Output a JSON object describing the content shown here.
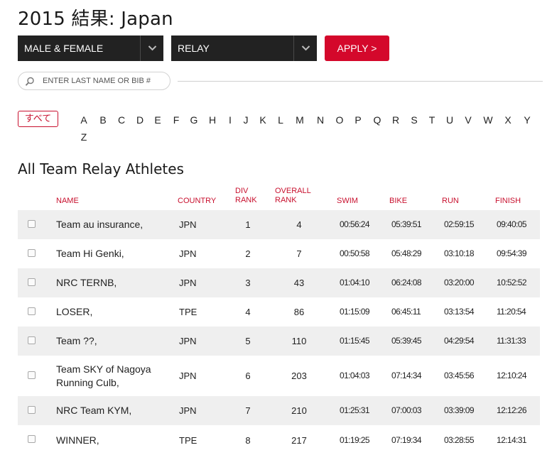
{
  "page_title": "2015 結果: Japan",
  "filters": {
    "gender": "MALE & FEMALE",
    "type": "RELAY",
    "apply_label": "APPLY >"
  },
  "search": {
    "placeholder": "ENTER LAST NAME OR BIB #"
  },
  "alphabet": {
    "all_label": "すべて",
    "letters": [
      "A",
      "B",
      "C",
      "D",
      "E",
      "F",
      "G",
      "H",
      "I",
      "J",
      "K",
      "L",
      "M",
      "N",
      "O",
      "P",
      "Q",
      "R",
      "S",
      "T",
      "U",
      "V",
      "W",
      "X",
      "Y",
      "Z"
    ]
  },
  "section_title": "All Team Relay Athletes",
  "table": {
    "headers": {
      "name": "NAME",
      "country": "COUNTRY",
      "div_rank": "DIV RANK",
      "overall_rank": "OVERALL RANK",
      "swim": "SWIM",
      "bike": "BIKE",
      "run": "RUN",
      "finish": "FINISH"
    },
    "rows": [
      {
        "name": "Team au insurance,",
        "country": "JPN",
        "div_rank": "1",
        "overall_rank": "4",
        "swim": "00:56:24",
        "bike": "05:39:51",
        "run": "02:59:15",
        "finish": "09:40:05"
      },
      {
        "name": "Team Hi Genki,",
        "country": "JPN",
        "div_rank": "2",
        "overall_rank": "7",
        "swim": "00:50:58",
        "bike": "05:48:29",
        "run": "03:10:18",
        "finish": "09:54:39"
      },
      {
        "name": "NRC TERNB,",
        "country": "JPN",
        "div_rank": "3",
        "overall_rank": "43",
        "swim": "01:04:10",
        "bike": "06:24:08",
        "run": "03:20:00",
        "finish": "10:52:52"
      },
      {
        "name": "LOSER,",
        "country": "TPE",
        "div_rank": "4",
        "overall_rank": "86",
        "swim": "01:15:09",
        "bike": "06:45:11",
        "run": "03:13:54",
        "finish": "11:20:54"
      },
      {
        "name": "Team ??,",
        "country": "JPN",
        "div_rank": "5",
        "overall_rank": "110",
        "swim": "01:15:45",
        "bike": "05:39:45",
        "run": "04:29:54",
        "finish": "11:31:33"
      },
      {
        "name": "Team SKY of Nagoya Running Culb,",
        "country": "JPN",
        "div_rank": "6",
        "overall_rank": "203",
        "swim": "01:04:03",
        "bike": "07:14:34",
        "run": "03:45:56",
        "finish": "12:10:24"
      },
      {
        "name": "NRC Team KYM,",
        "country": "JPN",
        "div_rank": "7",
        "overall_rank": "210",
        "swim": "01:25:31",
        "bike": "07:00:03",
        "run": "03:39:09",
        "finish": "12:12:26"
      },
      {
        "name": "WINNER,",
        "country": "TPE",
        "div_rank": "8",
        "overall_rank": "217",
        "swim": "01:19:25",
        "bike": "07:19:34",
        "run": "03:28:55",
        "finish": "12:14:31"
      }
    ]
  },
  "colors": {
    "accent": "#c8102e",
    "apply_bg": "#d4082b",
    "select_bg": "#222222",
    "row_alt": "#efefef"
  },
  "icons": {
    "search": "search-icon",
    "dropdown": "chevron-down-icon"
  }
}
